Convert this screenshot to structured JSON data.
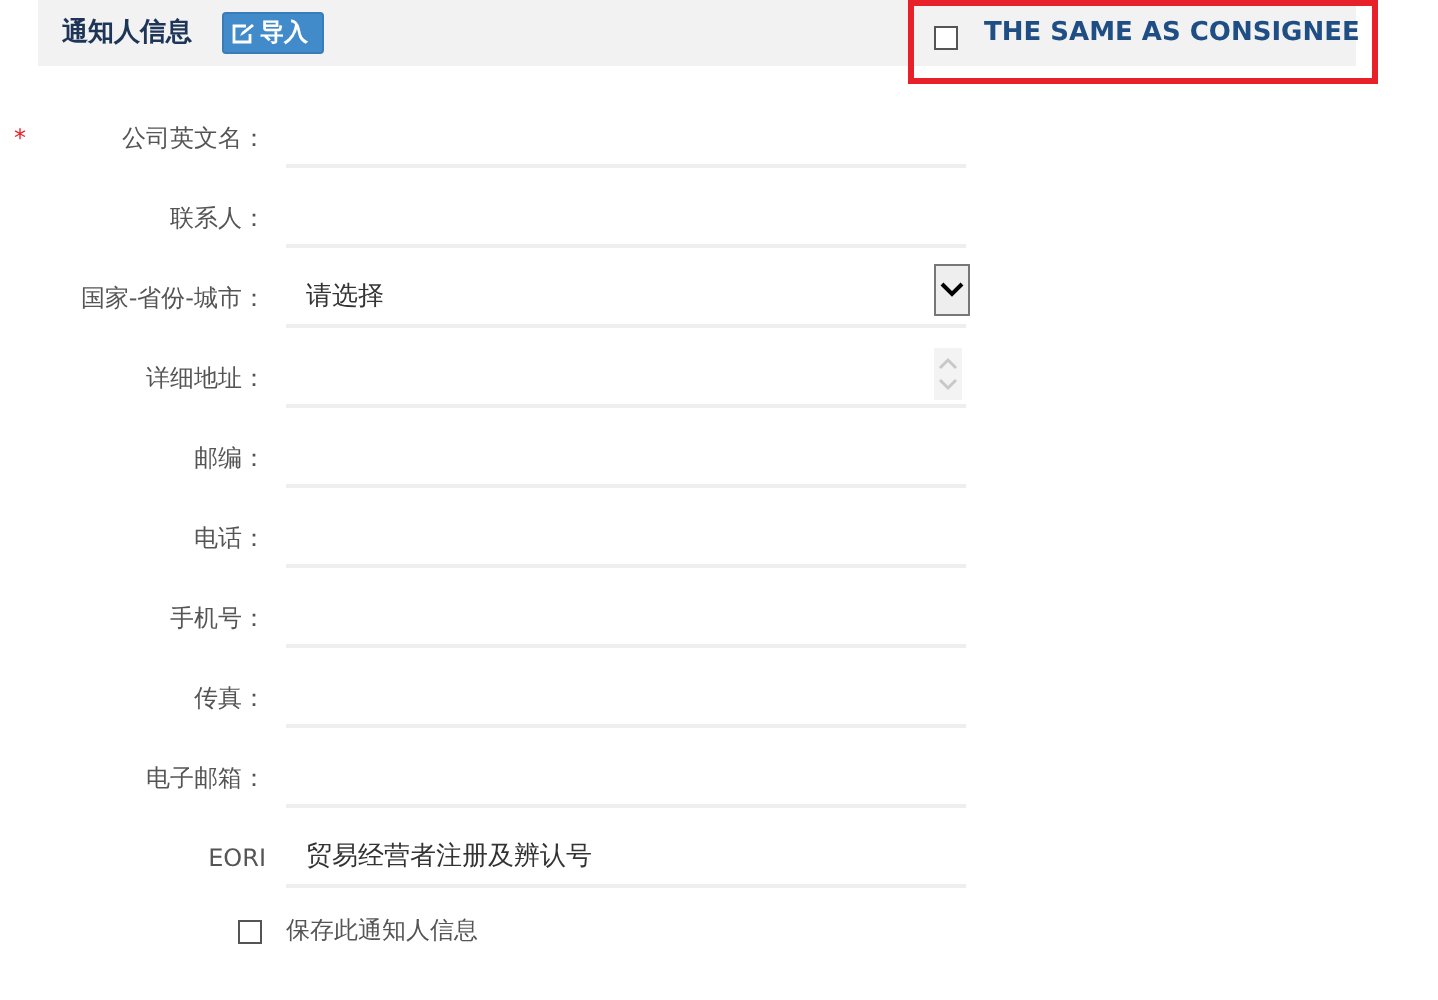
{
  "header": {
    "title": "通知人信息",
    "import_button": "导入",
    "same_as_consignee": {
      "label": "THE SAME AS CONSIGNEE",
      "checked": false,
      "highlighted": true
    }
  },
  "fields": [
    {
      "label": "公司英文名：",
      "required_mark": "*",
      "kind": "text"
    },
    {
      "label": "联系人：",
      "kind": "text"
    },
    {
      "label": "国家-省份-城市：",
      "kind": "select",
      "value": "请选择"
    },
    {
      "label": "详细地址：",
      "kind": "textarea"
    },
    {
      "label": "邮编：",
      "kind": "text"
    },
    {
      "label": "电话：",
      "kind": "text"
    },
    {
      "label": "手机号：",
      "kind": "text"
    },
    {
      "label": "传真：",
      "kind": "text"
    },
    {
      "label": "电子邮箱：",
      "kind": "text"
    },
    {
      "label": "EORI",
      "kind": "text",
      "placeholder": "贸易经营者注册及辨认号"
    }
  ],
  "save_option": {
    "label": "保存此通知人信息",
    "checked": false
  }
}
